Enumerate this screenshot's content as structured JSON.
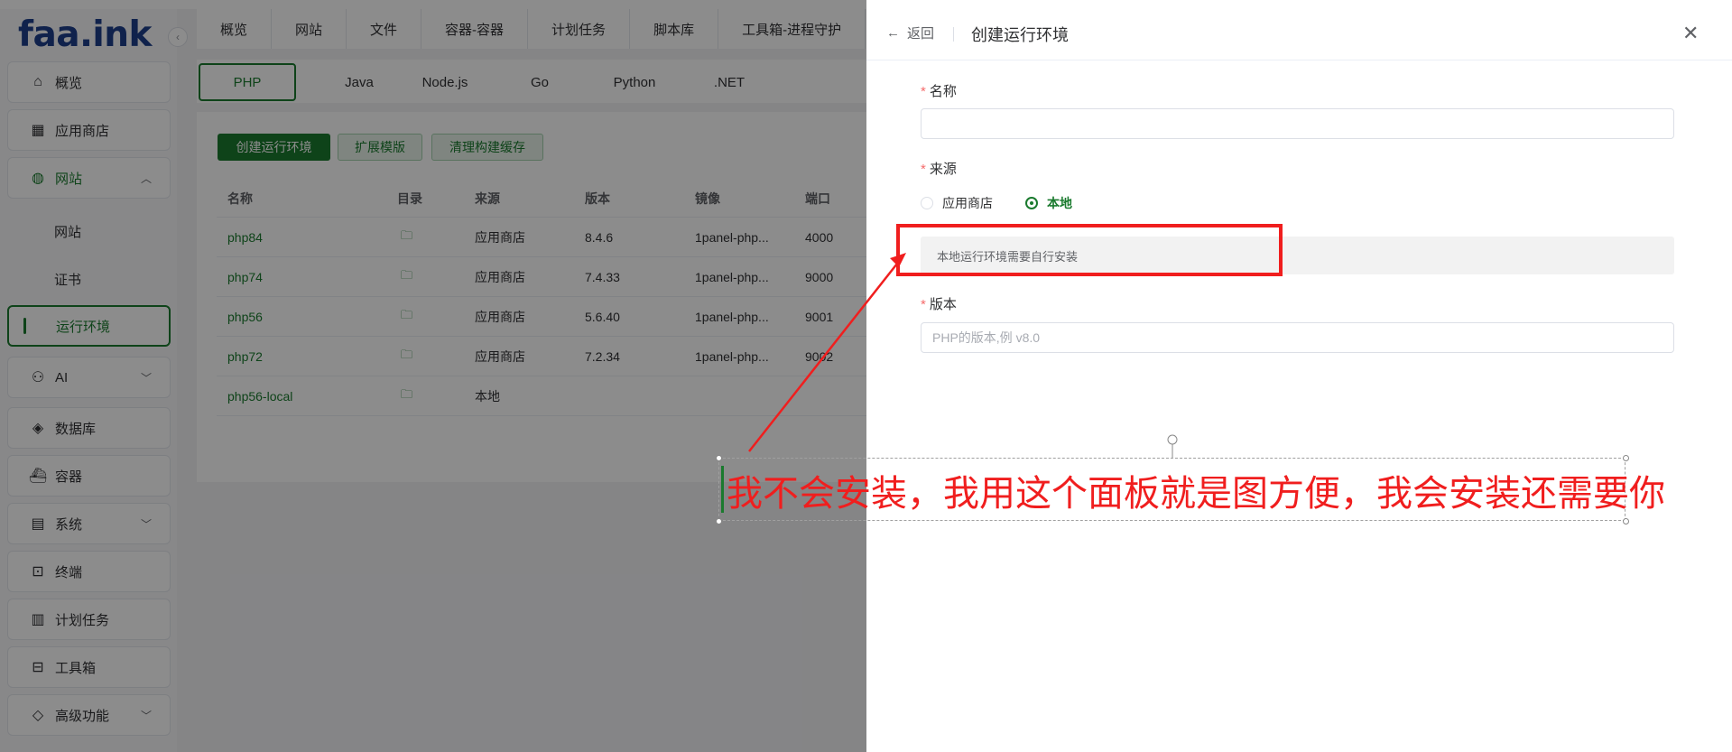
{
  "sidebar": {
    "logo": "faa.ink",
    "collapse_icon": "‹",
    "items": [
      {
        "label": "概览",
        "icon": "home-icon"
      },
      {
        "label": "应用商店",
        "icon": "grid-icon"
      },
      {
        "label": "网站",
        "icon": "globe-icon"
      },
      {
        "label": "AI",
        "icon": "robot-icon"
      },
      {
        "label": "数据库",
        "icon": "layers-icon"
      },
      {
        "label": "容器",
        "icon": "docker-icon"
      },
      {
        "label": "系统",
        "icon": "server-icon"
      },
      {
        "label": "终端",
        "icon": "terminal-icon"
      },
      {
        "label": "计划任务",
        "icon": "calendar-icon"
      },
      {
        "label": "工具箱",
        "icon": "toolbox-icon"
      },
      {
        "label": "高级功能",
        "icon": "diamond-icon"
      }
    ],
    "sub_items": [
      "网站",
      "证书",
      "运行环境"
    ]
  },
  "topnav": [
    "概览",
    "网站",
    "文件",
    "容器-容器",
    "计划任务",
    "脚本库",
    "工具箱-进程守护"
  ],
  "lang_tabs": [
    "PHP",
    "Java",
    "Node.js",
    "Go",
    "Python",
    ".NET"
  ],
  "toolbar": {
    "create": "创建运行环境",
    "ext": "扩展模版",
    "clean": "清理构建缓存"
  },
  "table": {
    "headers": [
      "名称",
      "目录",
      "来源",
      "版本",
      "镜像",
      "端口"
    ],
    "rows": [
      {
        "name": "php84",
        "source": "应用商店",
        "version": "8.4.6",
        "image": "1panel-php...",
        "port": "4000"
      },
      {
        "name": "php74",
        "source": "应用商店",
        "version": "7.4.33",
        "image": "1panel-php...",
        "port": "9000"
      },
      {
        "name": "php56",
        "source": "应用商店",
        "version": "5.6.40",
        "image": "1panel-php...",
        "port": "9001"
      },
      {
        "name": "php72",
        "source": "应用商店",
        "version": "7.2.34",
        "image": "1panel-php...",
        "port": "9002"
      },
      {
        "name": "php56-local",
        "source": "本地",
        "version": "",
        "image": "",
        "port": ""
      }
    ]
  },
  "drawer": {
    "back": "返回",
    "title": "创建运行环境",
    "name_label": "名称",
    "name_value": "",
    "source_label": "来源",
    "source_options": [
      "应用商店",
      "本地"
    ],
    "source_selected": "本地",
    "notice": "本地运行环境需要自行安装",
    "version_label": "版本",
    "version_placeholder": "PHP的版本,例 v8.0"
  },
  "annotation": {
    "text": "我不会安装，我用这个面板就是图方便，我会安装还需要你",
    "color": "#f01e1e"
  },
  "colors": {
    "accent": "#1a7a2e",
    "logo": "#1e3f8a"
  }
}
